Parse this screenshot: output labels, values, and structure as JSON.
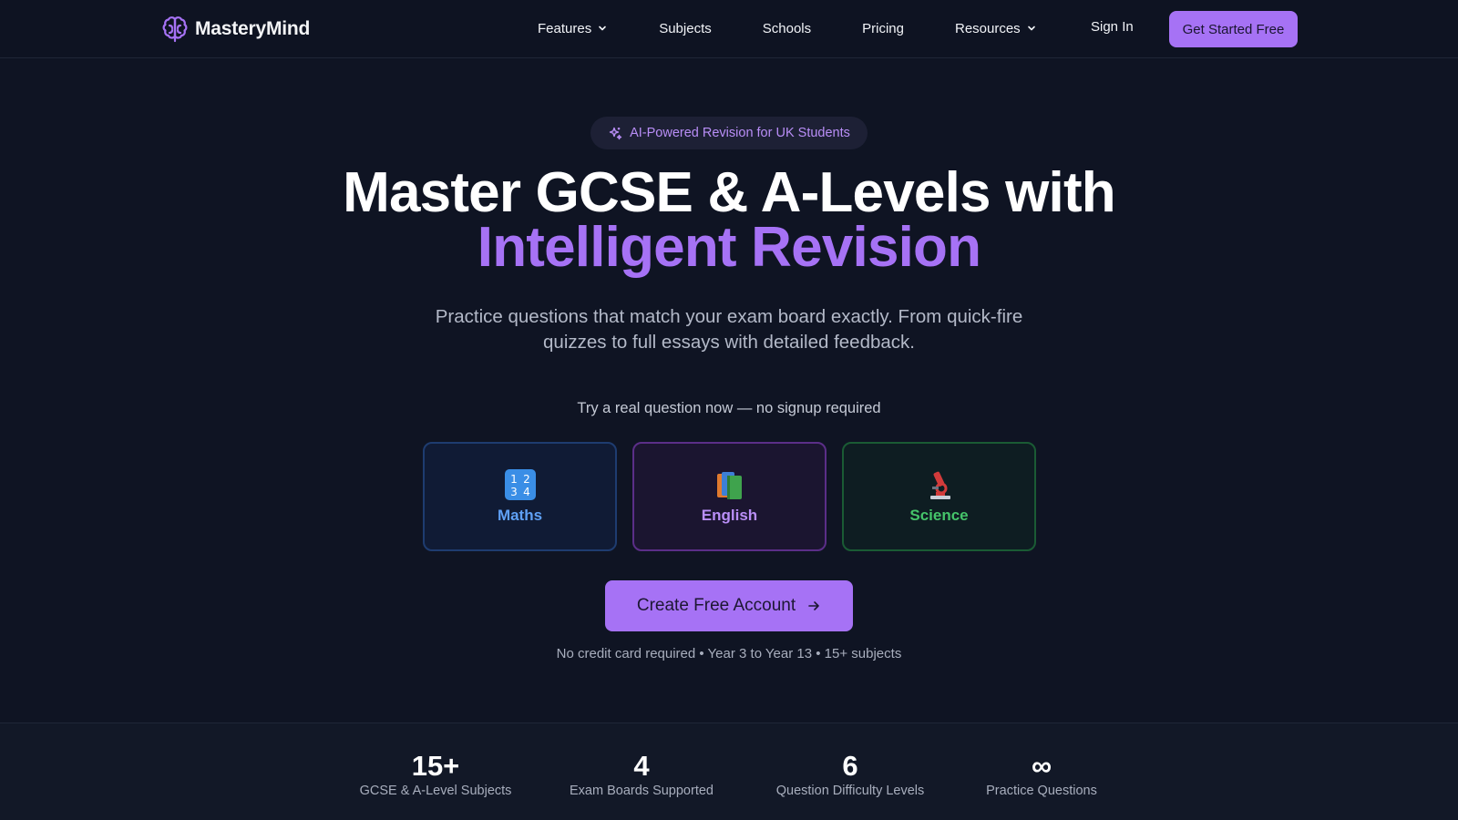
{
  "nav": {
    "brand": "MasteryMind",
    "links": [
      {
        "label": "Features",
        "dropdown": true
      },
      {
        "label": "Subjects",
        "dropdown": false
      },
      {
        "label": "Schools",
        "dropdown": false
      },
      {
        "label": "Pricing",
        "dropdown": false
      },
      {
        "label": "Resources",
        "dropdown": true
      }
    ],
    "sign_in": "Sign In",
    "cta": "Get Started Free"
  },
  "hero": {
    "badge": "AI-Powered Revision for UK Students",
    "headline_line1": "Master GCSE & A-Levels with",
    "headline_line2": "Intelligent Revision",
    "subtitle": "Practice questions that match your exam board exactly. From quick-fire quizzes to full essays with detailed feedback.",
    "try_prompt": "Try a real question now — no signup required",
    "subjects": [
      {
        "label": "Maths",
        "icon": "numbers-icon"
      },
      {
        "label": "English",
        "icon": "books-icon"
      },
      {
        "label": "Science",
        "icon": "microscope-icon"
      }
    ],
    "cta": "Create Free Account",
    "footnote": "No credit card required • Year 3 to Year 13 • 15+ subjects"
  },
  "stats": [
    {
      "value": "15+",
      "caption": "GCSE & A-Level Subjects"
    },
    {
      "value": "4",
      "caption": "Exam Boards Supported"
    },
    {
      "value": "6",
      "caption": "Question Difficulty Levels"
    },
    {
      "value": "∞",
      "caption": "Practice Questions"
    }
  ],
  "colors": {
    "background": "#0f1423",
    "accent": "#a672f5",
    "maths": "#5fa0f5",
    "english": "#b98ef7",
    "science": "#45c46a"
  }
}
